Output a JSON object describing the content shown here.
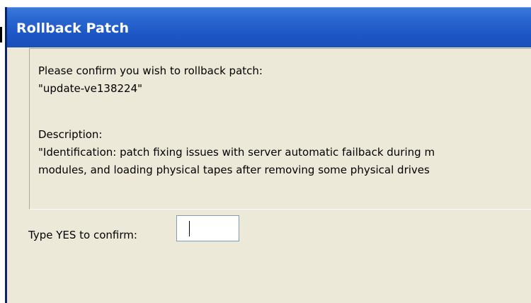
{
  "dialog": {
    "title": "Rollback Patch",
    "confirm_prompt": "Please confirm you wish to rollback patch:",
    "patch_name": "\"update-ve138224\"",
    "description_label": "Description:",
    "description_line1": "\"Identification: patch fixing issues with server automatic failback during m",
    "description_line2": "modules, and loading physical tapes after removing some physical drives",
    "confirm_label": "Type YES to confirm:",
    "confirm_value": ""
  },
  "colors": {
    "titlebar": "#1c55c5",
    "dialog_background": "#ece9d8",
    "input_border": "#7f9db9"
  }
}
